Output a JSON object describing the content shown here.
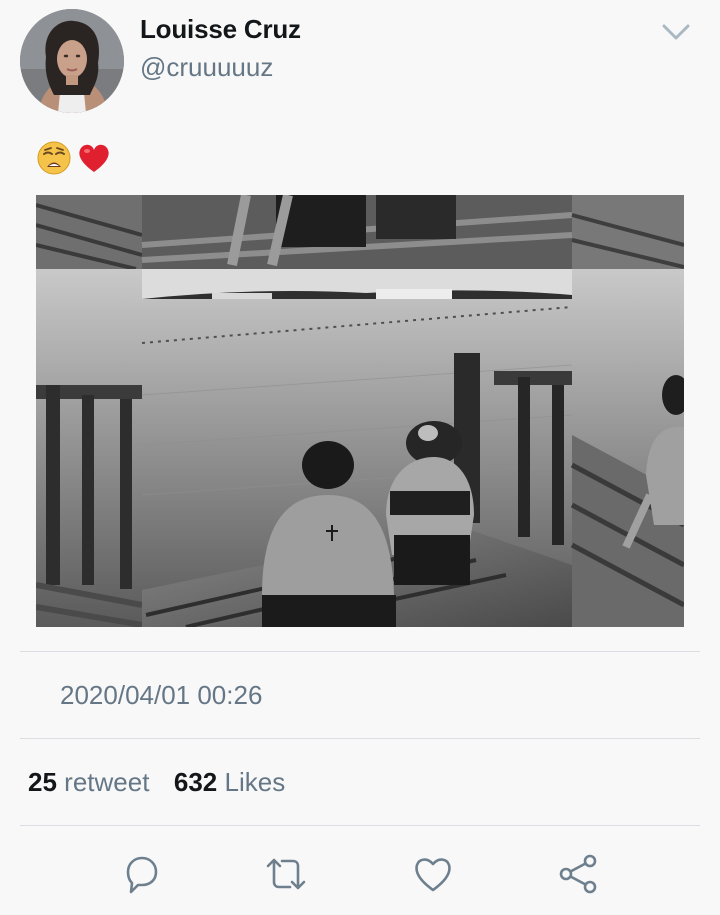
{
  "user": {
    "display_name": "Louisse Cruz",
    "handle": "@cruuuuuz"
  },
  "tweet": {
    "emojis": [
      "weary-face",
      "red-heart"
    ],
    "photo_description_icon": "photo",
    "timestamp": "2020/04/01 00:26"
  },
  "stats": {
    "retweet_count": "25",
    "retweet_label": "retweet",
    "like_count": "632",
    "like_label": "Likes"
  },
  "actions": {
    "icons": [
      "reply-icon",
      "retweet-icon",
      "like-icon",
      "share-icon"
    ]
  },
  "colors": {
    "text_primary": "#14171a",
    "text_secondary": "#657786",
    "icon": "#6e7f8e",
    "background": "#f8f8f8"
  }
}
